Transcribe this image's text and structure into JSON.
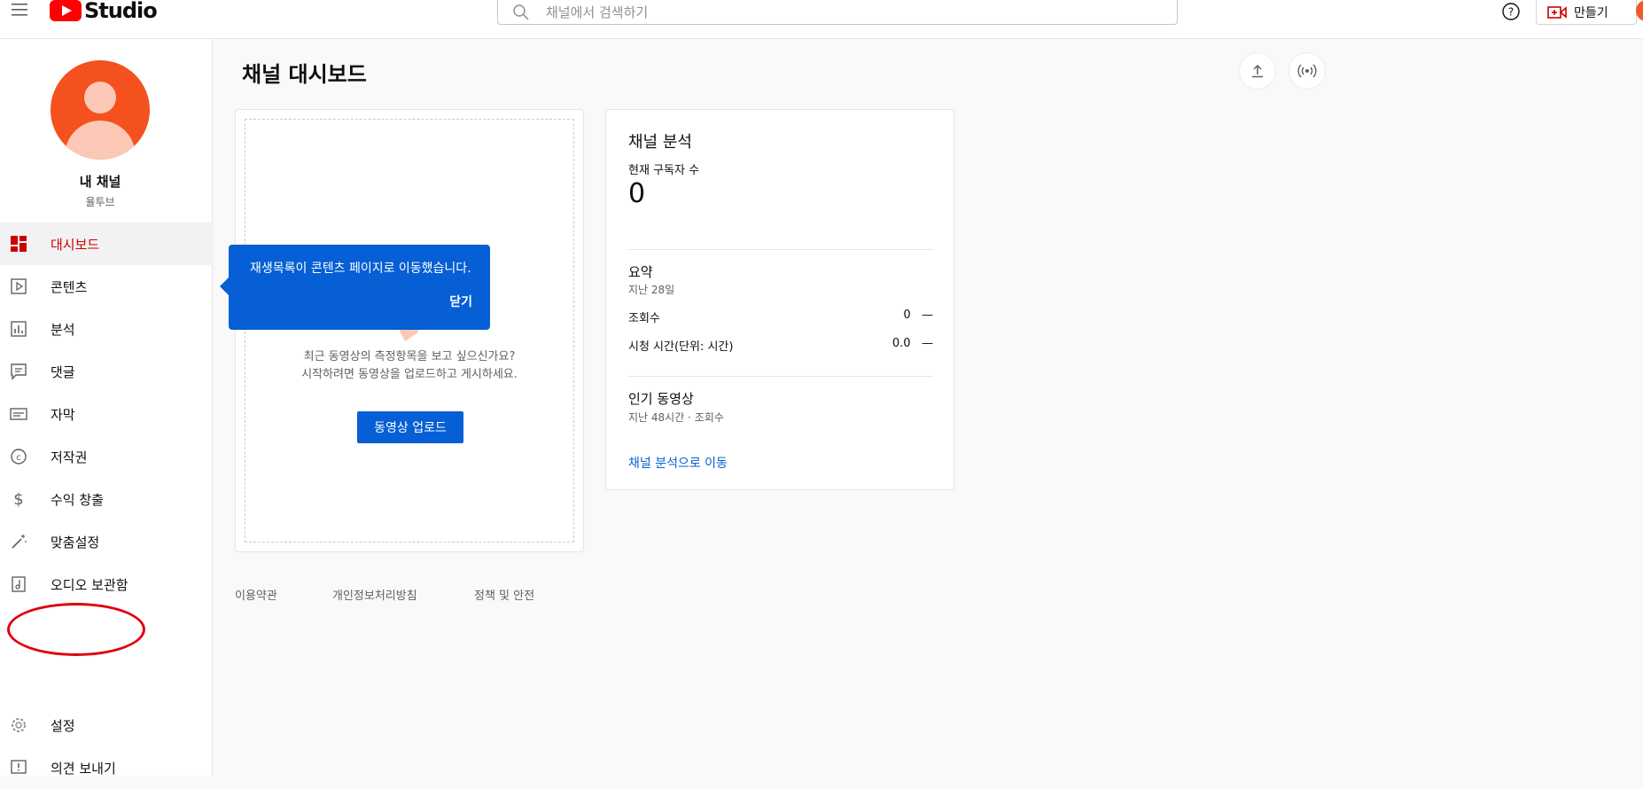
{
  "header": {
    "logo_text": "Studio",
    "search_placeholder": "채널에서 검색하기",
    "create_label": "만들기"
  },
  "sidebar": {
    "channel_name": "내 채널",
    "channel_handle": "율투브",
    "items": [
      {
        "label": "대시보드",
        "icon": "dashboard-icon"
      },
      {
        "label": "콘텐츠",
        "icon": "content-icon"
      },
      {
        "label": "분석",
        "icon": "analytics-icon"
      },
      {
        "label": "댓글",
        "icon": "comments-icon"
      },
      {
        "label": "자막",
        "icon": "subtitles-icon"
      },
      {
        "label": "저작권",
        "icon": "copyright-icon"
      },
      {
        "label": "수익 창출",
        "icon": "dollar-icon"
      },
      {
        "label": "맞춤설정",
        "icon": "magic-wand-icon"
      },
      {
        "label": "오디오 보관함",
        "icon": "audio-library-icon"
      }
    ],
    "settings_label": "설정",
    "feedback_label": "의견 보내기"
  },
  "main": {
    "title": "채널 대시보드",
    "upload_card": {
      "line1": "최근 동영상의 측정항목을 보고 싶으신가요?",
      "line2": "시작하려면 동영상을 업로드하고 게시하세요.",
      "button": "동영상 업로드"
    },
    "tooltip": {
      "message": "재생목록이 콘텐츠 페이지로 이동했습니다.",
      "close": "닫기"
    },
    "analytics": {
      "title": "채널 분석",
      "subscribers_label": "현재 구독자 수",
      "subscribers_value": "0",
      "summary_title": "요약",
      "summary_period": "지난 28일",
      "rows": [
        {
          "label": "조회수",
          "value": "0",
          "trend": "—"
        },
        {
          "label": "시청 시간(단위: 시간)",
          "value": "0.0",
          "trend": "—"
        }
      ],
      "top_videos_title": "인기 동영상",
      "top_videos_sub": "지난 48시간 · 조회수",
      "link": "채널 분석으로 이동"
    },
    "footer": [
      "이용약관",
      "개인정보처리방침",
      "정책 및 안전"
    ]
  },
  "colors": {
    "brand_red": "#ff0000",
    "active_red": "#cc0000",
    "accent_blue": "#065fd4",
    "avatar_orange": "#f4511e"
  }
}
